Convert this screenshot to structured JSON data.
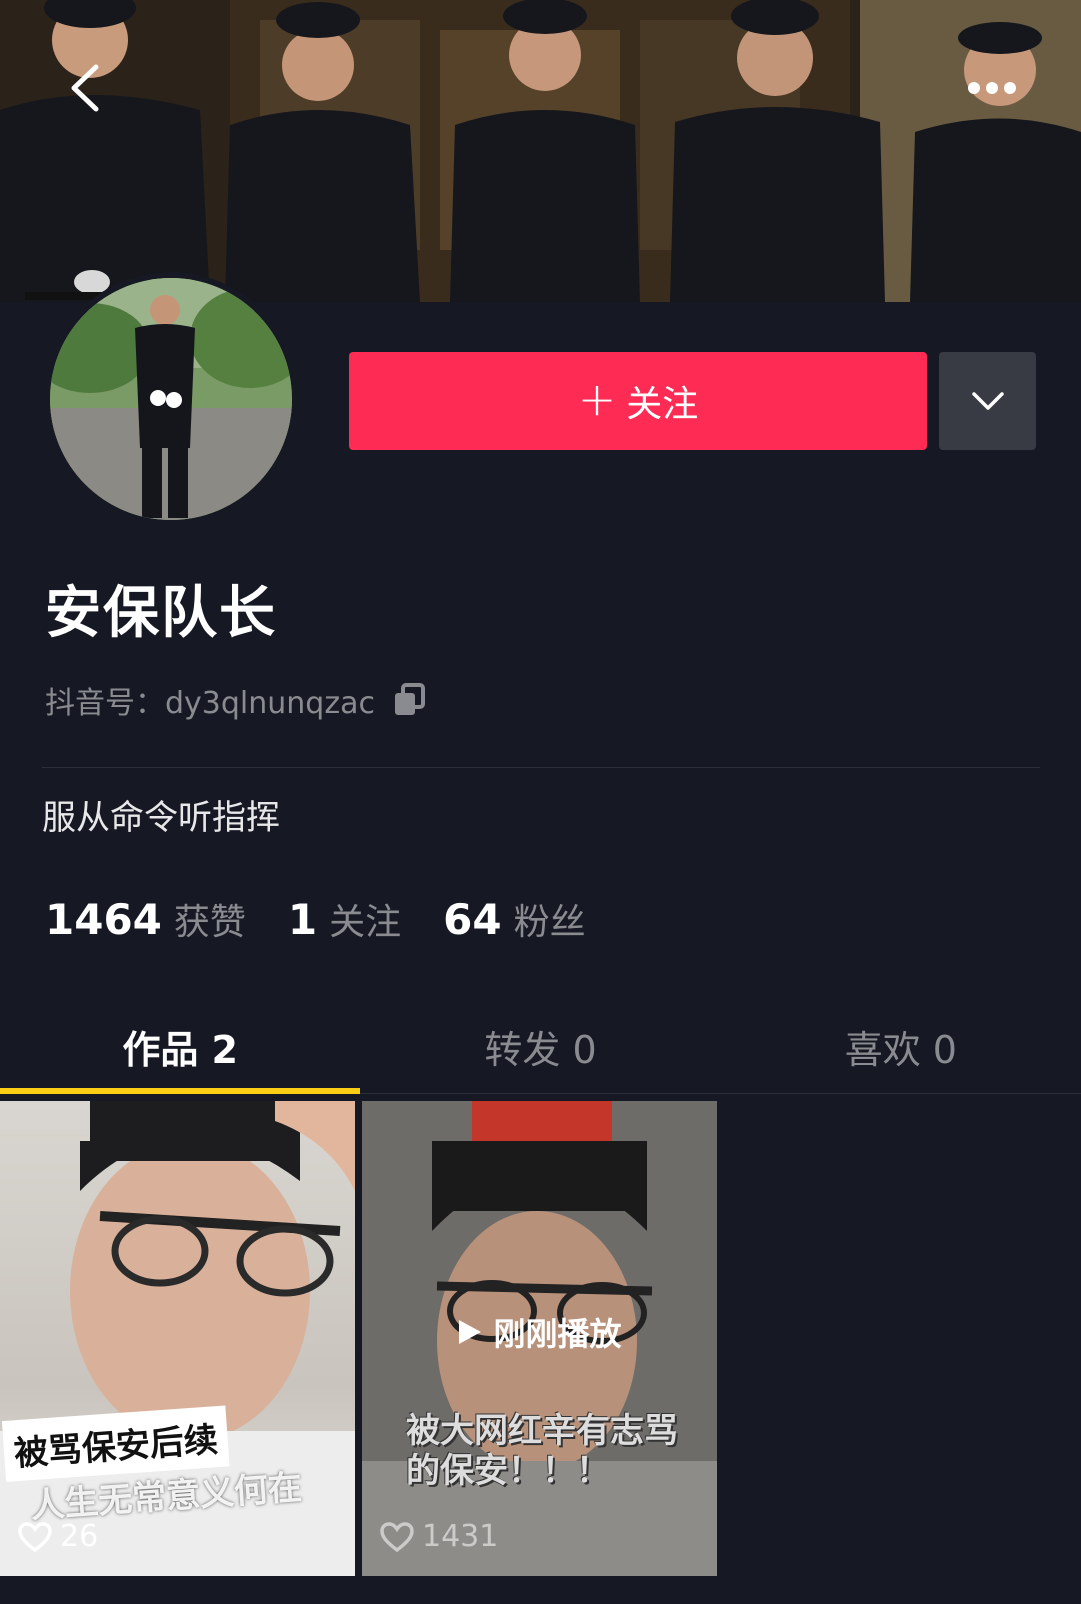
{
  "header": {
    "back_icon": "chevron-left-icon",
    "more_icon": "more-dots-icon"
  },
  "profile": {
    "nickname": "安保队长",
    "douyin_id_label": "抖音号：",
    "douyin_id": "dy3qlnunqzac",
    "bio": "服从命令听指挥",
    "follow_label": "关注",
    "follow_plus": "+"
  },
  "stats": [
    {
      "value": "1464",
      "label": "获赞"
    },
    {
      "value": "1",
      "label": "关注"
    },
    {
      "value": "64",
      "label": "粉丝"
    }
  ],
  "tabs": [
    {
      "label": "作品 2",
      "active": true
    },
    {
      "label": "转发 0",
      "active": false
    },
    {
      "label": "喜欢 0",
      "active": false
    }
  ],
  "videos": [
    {
      "likes": "26",
      "caption": "被骂保安后续",
      "caption_sub": "人生无常意义何在"
    },
    {
      "likes": "1431",
      "caption": "被大网红辛有志骂的保安！！！",
      "overlay": "刚刚播放"
    }
  ],
  "colors": {
    "background": "#161823",
    "follow": "#fe2c55",
    "tab_indicator": "#face15",
    "muted_text": "#8a8b91"
  }
}
